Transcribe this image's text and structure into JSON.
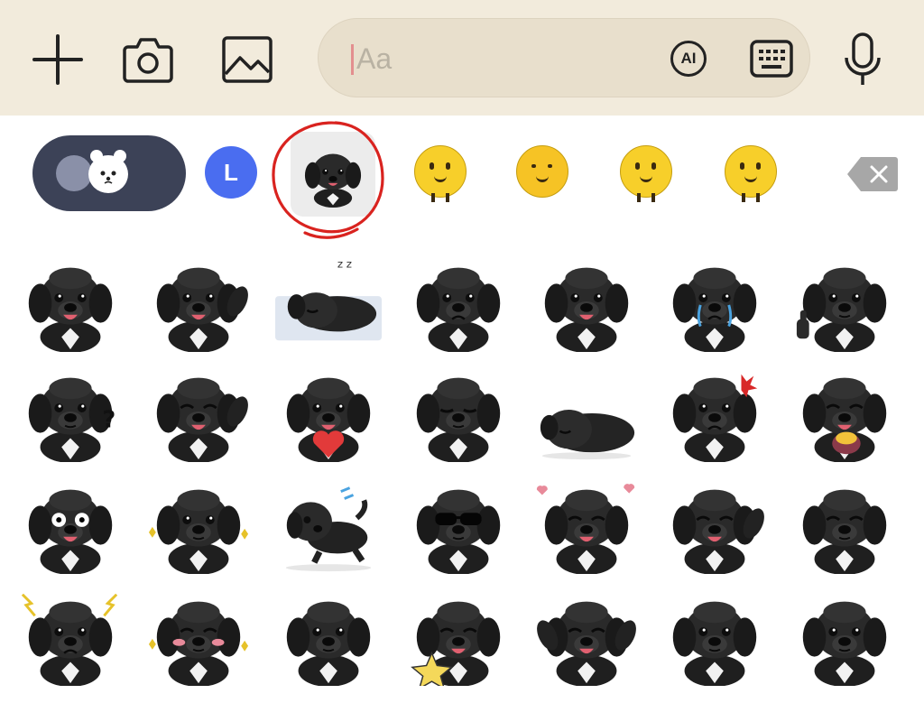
{
  "composer": {
    "placeholder": "Aa",
    "ai_label": "AI",
    "icons": [
      "plus-icon",
      "camera-icon",
      "image-icon",
      "ai-icon",
      "keyboard-icon",
      "microphone-icon"
    ]
  },
  "tabs": {
    "l_label": "L",
    "selected_index": 2,
    "items": [
      "emoji",
      "L",
      "dog-stickers",
      "yellow-blob-1",
      "yellow-blob-2",
      "yellow-blob-3",
      "yellow-blob-4"
    ]
  },
  "colors": {
    "topbar_bg": "#f2ebdc",
    "field_bg": "#e8dfcc",
    "emoji_tab_bg": "#3c4257",
    "l_tab_bg": "#4a6df0",
    "annotation_red": "#d9231f",
    "delete_bg": "#a7a7a7"
  },
  "stickers": {
    "rows": 4,
    "cols": 7,
    "items": [
      {
        "mood": "smile",
        "extra": ""
      },
      {
        "mood": "smile",
        "extra": "wave"
      },
      {
        "mood": "sleep",
        "extra": "zzz"
      },
      {
        "mood": "sad",
        "extra": ""
      },
      {
        "mood": "smile",
        "extra": ""
      },
      {
        "mood": "cry",
        "extra": "tears"
      },
      {
        "mood": "neutral",
        "extra": "thumbs-up"
      },
      {
        "mood": "neutral",
        "extra": "question"
      },
      {
        "mood": "happy",
        "extra": "wave"
      },
      {
        "mood": "smile",
        "extra": "heart"
      },
      {
        "mood": "bow",
        "extra": ""
      },
      {
        "mood": "sleep",
        "extra": "lying"
      },
      {
        "mood": "angry",
        "extra": "anger-mark"
      },
      {
        "mood": "happy",
        "extra": "sweet-potato"
      },
      {
        "mood": "shock",
        "extra": ""
      },
      {
        "mood": "tense",
        "extra": "sparks"
      },
      {
        "mood": "run",
        "extra": "sweat"
      },
      {
        "mood": "cool",
        "extra": "sunglasses"
      },
      {
        "mood": "happy",
        "extra": "hearts"
      },
      {
        "mood": "happy",
        "extra": "wave"
      },
      {
        "mood": "giggle",
        "extra": "paw-mouth"
      },
      {
        "mood": "angry",
        "extra": "lightning"
      },
      {
        "mood": "blush",
        "extra": "sparkles"
      },
      {
        "mood": "neutral",
        "extra": ""
      },
      {
        "mood": "happy",
        "extra": "star"
      },
      {
        "mood": "happy",
        "extra": "arms-up"
      },
      {
        "mood": "neutral",
        "extra": "sitting"
      },
      {
        "mood": "neutral",
        "extra": "pose"
      }
    ]
  }
}
